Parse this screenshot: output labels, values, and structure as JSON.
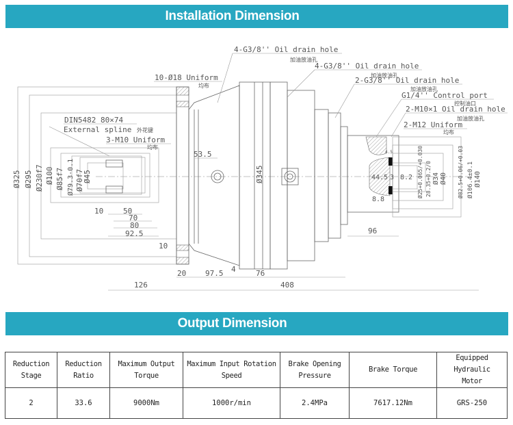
{
  "sections": {
    "installation_title": "Installation Dimension",
    "output_title": "Output Dimension"
  },
  "colors": {
    "banner_bg": "#27a7c1",
    "banner_text": "#ffffff"
  },
  "drawing": {
    "callouts": {
      "oil_drain_1": "4-G3/8'' Oil drain hole",
      "oil_drain_1_cn": "加油放油孔",
      "oil_drain_2": "4-G3/8'' Oil drain hole",
      "oil_drain_2_cn": "加油放油孔",
      "oil_drain_3": "2-G3/8'' Oil drain hole",
      "oil_drain_3_cn": "加油放油孔",
      "control_port": "G1/4'' Control port",
      "control_port_cn": "控制油口",
      "oil_drain_4": "2-M10×1 Oil drain hole",
      "oil_drain_4_cn": "加油放油孔",
      "m12_uniform": "2-M12 Uniform",
      "m12_uniform_cn": "均布",
      "holes_18": "10-Ø18 Uniform",
      "holes_18_cn": "均布",
      "spline_std": "DIN5482  80×74",
      "spline_type": "External spline",
      "spline_type_cn": "外花键",
      "m10_uniform": "3-M10 Uniform",
      "m10_uniform_cn": "均布"
    },
    "left_diameters": [
      "Ø325",
      "Ø295",
      "Ø230f7",
      "Ø100",
      "Ø85f7",
      "Ø79.3-0.1",
      "Ø70f7",
      "Ø45"
    ],
    "horizontal_dims": {
      "d10a": "10",
      "d50": "50",
      "d70": "70",
      "d80": "80",
      "d92_5": "92.5",
      "d10b": "10",
      "d53_5": "53.5",
      "d20": "20",
      "d97_5": "97.5",
      "d4": "4",
      "d76": "76",
      "d126": "126",
      "d408": "408",
      "d96": "96",
      "d44_5": "44.5",
      "d3": "3",
      "d8_2": "8.2",
      "d8_8": "8.8",
      "d4_5": "4.5"
    },
    "center_diameter": "Ø345",
    "right_diameters": [
      "Ø25+0.065/+0.030",
      "28.35+0.2/0",
      "Ø34",
      "Ø40",
      "Ø82.5+0.06/+0.03",
      "Ø106.4±0.1",
      "Ø140"
    ]
  },
  "table": {
    "headers": [
      "Reduction\nStage",
      "Reduction\nRatio",
      "Maximum Output\nTorque",
      "Maximum Input Rotation\nSpeed",
      "Brake Opening\nPressure",
      "Brake Torque",
      "Equipped Hydraulic\nMotor"
    ],
    "rows": [
      [
        "2",
        "33.6",
        "9000Nm",
        "1000r/min",
        "2.4MPa",
        "7617.12Nm",
        "GRS-250"
      ]
    ]
  }
}
